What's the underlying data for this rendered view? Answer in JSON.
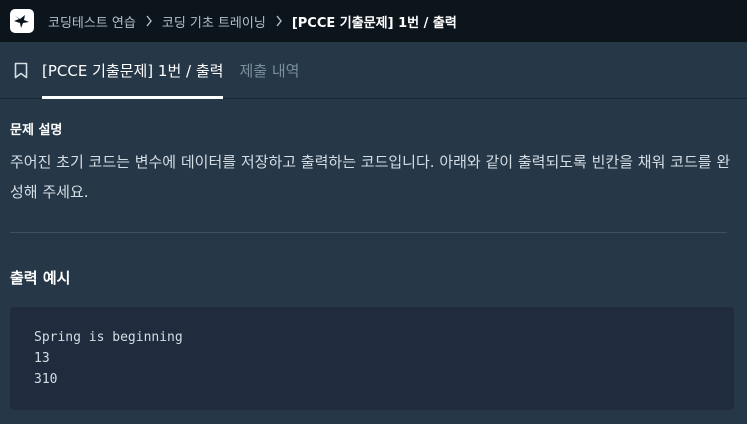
{
  "breadcrumbs": [
    {
      "label": "코딩테스트 연습"
    },
    {
      "label": "코딩 기초 트레이닝"
    },
    {
      "label": "[PCCE 기출문제] 1번 / 출력"
    }
  ],
  "tabs": [
    {
      "label": "[PCCE 기출문제] 1번 / 출력",
      "active": true
    },
    {
      "label": "제출 내역",
      "active": false
    }
  ],
  "problem": {
    "title": "문제 설명",
    "description": "주어진 초기 코드는 변수에 데이터를 저장하고 출력하는 코드입니다. 아래와 같이 출력되도록 빈칸을 채워 코드를 완성해 주세요."
  },
  "example": {
    "title": "출력 예시",
    "lines": [
      "Spring is beginning",
      "13",
      "310"
    ]
  },
  "colors": {
    "topbar": "#0c151c",
    "background": "#263747",
    "code_bg": "#202b3d",
    "inactive_tab": "#78909c"
  },
  "icons": {
    "logo": "logo-icon",
    "separator": "chevron-right-icon",
    "bookmark": "bookmark-icon"
  }
}
